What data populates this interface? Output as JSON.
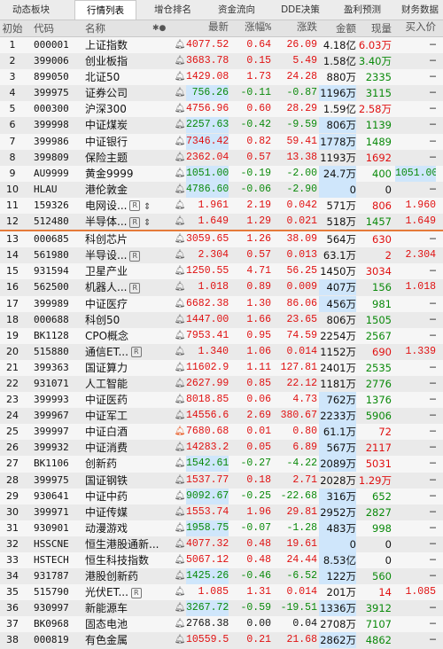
{
  "tabs": [
    {
      "label": "动态板块",
      "active": false
    },
    {
      "label": "行情列表",
      "active": true
    },
    {
      "label": "增仓排名",
      "active": false
    },
    {
      "label": "资金流向",
      "active": false
    },
    {
      "label": "DDE决策",
      "active": false
    },
    {
      "label": "盈利预测",
      "active": false
    },
    {
      "label": "财务数据",
      "active": false
    }
  ],
  "header": {
    "idx": "初始",
    "code": "代码",
    "name": "名称",
    "dots": "✱●",
    "price": "最新",
    "pct": "涨幅%",
    "chg": "涨跌",
    "amt": "金额",
    "vol": "现量",
    "buy": "买入价"
  },
  "rows": [
    {
      "i": "1",
      "code": "000001",
      "name": "上证指数",
      "price": "4077.52",
      "pct": "0.64",
      "chg": "26.09",
      "amt": "4.18亿",
      "vol": "6.03万",
      "buy": "—",
      "dir": "up",
      "volColor": "up"
    },
    {
      "i": "2",
      "code": "399006",
      "name": "创业板指",
      "price": "3683.78",
      "pct": "0.15",
      "chg": "5.49",
      "amt": "1.58亿",
      "vol": "3.40万",
      "buy": "—",
      "dir": "up",
      "volColor": "down"
    },
    {
      "i": "3",
      "code": "899050",
      "name": "北证50",
      "price": "1429.08",
      "pct": "1.73",
      "chg": "24.28",
      "amt": "880万",
      "vol": "2335",
      "buy": "—",
      "dir": "up",
      "volColor": "down"
    },
    {
      "i": "4",
      "code": "399975",
      "name": "证券公司",
      "price": "756.26",
      "pct": "-0.11",
      "chg": "-0.87",
      "amt": "1196万",
      "vol": "3115",
      "buy": "—",
      "dir": "down",
      "volColor": "down",
      "hl": true
    },
    {
      "i": "5",
      "code": "000300",
      "name": "沪深300",
      "price": "4756.96",
      "pct": "0.60",
      "chg": "28.29",
      "amt": "1.59亿",
      "vol": "2.58万",
      "buy": "—",
      "dir": "up",
      "volColor": "up"
    },
    {
      "i": "6",
      "code": "399998",
      "name": "中证煤炭",
      "price": "2257.63",
      "pct": "-0.42",
      "chg": "-9.59",
      "amt": "806万",
      "vol": "1139",
      "buy": "—",
      "dir": "down",
      "volColor": "down",
      "hl": true
    },
    {
      "i": "7",
      "code": "399986",
      "name": "中证银行",
      "price": "7346.42",
      "pct": "0.82",
      "chg": "59.41",
      "amt": "1778万",
      "vol": "1489",
      "buy": "—",
      "dir": "up",
      "volColor": "down",
      "hl": true
    },
    {
      "i": "8",
      "code": "399809",
      "name": "保险主题",
      "price": "2362.04",
      "pct": "0.57",
      "chg": "13.38",
      "amt": "1193万",
      "vol": "1692",
      "buy": "—",
      "dir": "up",
      "volColor": "up"
    },
    {
      "i": "9",
      "code": "AU9999",
      "name": "黄金9999",
      "price": "1051.00",
      "pct": "-0.19",
      "chg": "-2.00",
      "amt": "24.7万",
      "vol": "400",
      "buy": "1051.00",
      "dir": "down",
      "volColor": "down",
      "hl": true,
      "buyhl": true
    },
    {
      "i": "10",
      "code": "HLAU",
      "name": "港伦敦金",
      "price": "4786.60",
      "pct": "-0.06",
      "chg": "-2.90",
      "amt": "0",
      "vol": "0",
      "buy": "—",
      "dir": "down",
      "volColor": "flat",
      "hl": true
    },
    {
      "i": "11",
      "code": "159326",
      "name": "电网设...",
      "badge": "R",
      "ex": "⇕",
      "price": "1.961",
      "pct": "2.19",
      "chg": "0.042",
      "amt": "571万",
      "vol": "806",
      "buy": "1.960",
      "dir": "up",
      "volColor": "up"
    },
    {
      "i": "12",
      "code": "512480",
      "name": "半导体...",
      "badge": "R",
      "ex": "⇕",
      "price": "1.649",
      "pct": "1.29",
      "chg": "0.021",
      "amt": "518万",
      "vol": "1457",
      "buy": "1.649",
      "dir": "up",
      "volColor": "down"
    },
    {
      "i": "13",
      "code": "000685",
      "name": "科创芯片",
      "price": "3059.65",
      "pct": "1.26",
      "chg": "38.09",
      "amt": "564万",
      "vol": "630",
      "buy": "—",
      "dir": "up",
      "volColor": "up"
    },
    {
      "i": "14",
      "code": "561980",
      "name": "半导设...",
      "badge": "R",
      "price": "2.304",
      "pct": "0.57",
      "chg": "0.013",
      "amt": "63.1万",
      "vol": "2",
      "buy": "2.304",
      "dir": "up",
      "volColor": "up"
    },
    {
      "i": "15",
      "code": "931594",
      "name": "卫星产业",
      "price": "1250.55",
      "pct": "4.71",
      "chg": "56.25",
      "amt": "1450万",
      "vol": "3034",
      "buy": "—",
      "dir": "up",
      "volColor": "up"
    },
    {
      "i": "16",
      "code": "562500",
      "name": "机器人...",
      "badge": "R",
      "price": "1.018",
      "pct": "0.89",
      "chg": "0.009",
      "amt": "407万",
      "vol": "156",
      "buy": "1.018",
      "dir": "up",
      "volColor": "down",
      "amthl": true
    },
    {
      "i": "17",
      "code": "399989",
      "name": "中证医疗",
      "price": "6682.38",
      "pct": "1.30",
      "chg": "86.06",
      "amt": "456万",
      "vol": "981",
      "buy": "—",
      "dir": "up",
      "volColor": "down",
      "amthl": true
    },
    {
      "i": "18",
      "code": "000688",
      "name": "科创50",
      "price": "1447.00",
      "pct": "1.66",
      "chg": "23.65",
      "amt": "806万",
      "vol": "1505",
      "buy": "—",
      "dir": "up",
      "volColor": "down"
    },
    {
      "i": "19",
      "code": "BK1128",
      "name": "CPO概念",
      "price": "7953.41",
      "pct": "0.95",
      "chg": "74.59",
      "amt": "2254万",
      "vol": "2567",
      "buy": "—",
      "dir": "up",
      "volColor": "down"
    },
    {
      "i": "20",
      "code": "515880",
      "name": "通信ET...",
      "badge": "R",
      "price": "1.340",
      "pct": "1.06",
      "chg": "0.014",
      "amt": "1152万",
      "vol": "690",
      "buy": "1.339",
      "dir": "up",
      "volColor": "up"
    },
    {
      "i": "21",
      "code": "399363",
      "name": "国证算力",
      "price": "11602.94",
      "pct": "1.11",
      "chg": "127.81",
      "amt": "2401万",
      "vol": "2535",
      "buy": "—",
      "dir": "up",
      "volColor": "down"
    },
    {
      "i": "22",
      "code": "931071",
      "name": "人工智能",
      "price": "2627.99",
      "pct": "0.85",
      "chg": "22.12",
      "amt": "1181万",
      "vol": "2776",
      "buy": "—",
      "dir": "up",
      "volColor": "down"
    },
    {
      "i": "23",
      "code": "399993",
      "name": "中证医药",
      "price": "8018.85",
      "pct": "0.06",
      "chg": "4.73",
      "amt": "762万",
      "vol": "1376",
      "buy": "—",
      "dir": "up",
      "volColor": "down",
      "amthl": true
    },
    {
      "i": "24",
      "code": "399967",
      "name": "中证军工",
      "price": "14556.67",
      "pct": "2.69",
      "chg": "380.67",
      "amt": "2233万",
      "vol": "5906",
      "buy": "—",
      "dir": "up",
      "volColor": "down",
      "amthl": true
    },
    {
      "i": "25",
      "code": "399997",
      "name": "中证白酒",
      "bellOn": true,
      "price": "7680.68",
      "pct": "0.01",
      "chg": "0.80",
      "amt": "61.1万",
      "vol": "72",
      "buy": "—",
      "dir": "up",
      "volColor": "up",
      "amthl": true
    },
    {
      "i": "26",
      "code": "399932",
      "name": "中证消费",
      "price": "14283.26",
      "pct": "0.05",
      "chg": "6.89",
      "amt": "567万",
      "vol": "2117",
      "buy": "—",
      "dir": "up",
      "volColor": "up",
      "amthl": true
    },
    {
      "i": "27",
      "code": "BK1106",
      "name": "创新药",
      "price": "1542.61",
      "pct": "-0.27",
      "chg": "-4.22",
      "amt": "2089万",
      "vol": "5031",
      "buy": "—",
      "dir": "down",
      "volColor": "up",
      "hl": true
    },
    {
      "i": "28",
      "code": "399975b",
      "code_display": "399975",
      "name": "国证钢铁",
      "price": "1537.77",
      "pct": "0.18",
      "chg": "2.71",
      "amt": "2028万",
      "vol": "1.29万",
      "buy": "—",
      "dir": "up",
      "volColor": "up"
    },
    {
      "i": "29",
      "code": "930641",
      "name": "中证中药",
      "price": "9092.67",
      "pct": "-0.25",
      "chg": "-22.68",
      "amt": "316万",
      "vol": "652",
      "buy": "—",
      "dir": "down",
      "volColor": "down",
      "hl": true
    },
    {
      "i": "30",
      "code": "399971",
      "name": "中证传媒",
      "price": "1553.74",
      "pct": "1.96",
      "chg": "29.81",
      "amt": "2952万",
      "vol": "2827",
      "buy": "—",
      "dir": "up",
      "volColor": "down",
      "amthl": true
    },
    {
      "i": "31",
      "code": "930901",
      "name": "动漫游戏",
      "price": "1958.75",
      "pct": "-0.07",
      "chg": "-1.28",
      "amt": "483万",
      "vol": "998",
      "buy": "—",
      "dir": "down",
      "volColor": "down",
      "hl": true
    },
    {
      "i": "32",
      "code": "HSSCNE",
      "name": "恒生港股通新...",
      "price": "4077.32",
      "pct": "0.48",
      "chg": "19.61",
      "amt": "0",
      "vol": "0",
      "buy": "—",
      "dir": "up",
      "volColor": "flat",
      "amthl": true
    },
    {
      "i": "33",
      "code": "HSTECH",
      "name": "恒生科技指数",
      "price": "5067.12",
      "pct": "0.48",
      "chg": "24.44",
      "amt": "8.53亿",
      "vol": "0",
      "buy": "—",
      "dir": "up",
      "volColor": "flat",
      "amthl": true
    },
    {
      "i": "34",
      "code": "931787",
      "name": "港股创新药",
      "price": "1425.26",
      "pct": "-0.46",
      "chg": "-6.52",
      "amt": "122万",
      "vol": "560",
      "buy": "—",
      "dir": "down",
      "volColor": "down",
      "hl": true
    },
    {
      "i": "35",
      "code": "515790",
      "name": "光伏ET...",
      "badge": "R",
      "price": "1.085",
      "pct": "1.31",
      "chg": "0.014",
      "amt": "201万",
      "vol": "14",
      "buy": "1.085",
      "dir": "up",
      "volColor": "up"
    },
    {
      "i": "36",
      "code": "930997",
      "name": "新能源车",
      "price": "3267.72",
      "pct": "-0.59",
      "chg": "-19.51",
      "amt": "1336万",
      "vol": "3912",
      "buy": "—",
      "dir": "down",
      "volColor": "down",
      "hl": true
    },
    {
      "i": "37",
      "code": "BK0968",
      "name": "固态电池",
      "price": "2768.38",
      "pct": "0.00",
      "chg": "0.04",
      "amt": "2708万",
      "vol": "7107",
      "buy": "—",
      "dir": "flat",
      "volColor": "down"
    },
    {
      "i": "38",
      "code": "000819",
      "name": "有色金属",
      "price": "10559.50",
      "pct": "0.21",
      "chg": "21.68",
      "amt": "2862万",
      "vol": "4862",
      "buy": "—",
      "dir": "up",
      "volColor": "down",
      "amthl": true
    }
  ],
  "colors": {
    "up": "#e01010",
    "down": "#0a8a0a",
    "highlight": "#cfe6fb",
    "separator": "#e57a3a"
  }
}
